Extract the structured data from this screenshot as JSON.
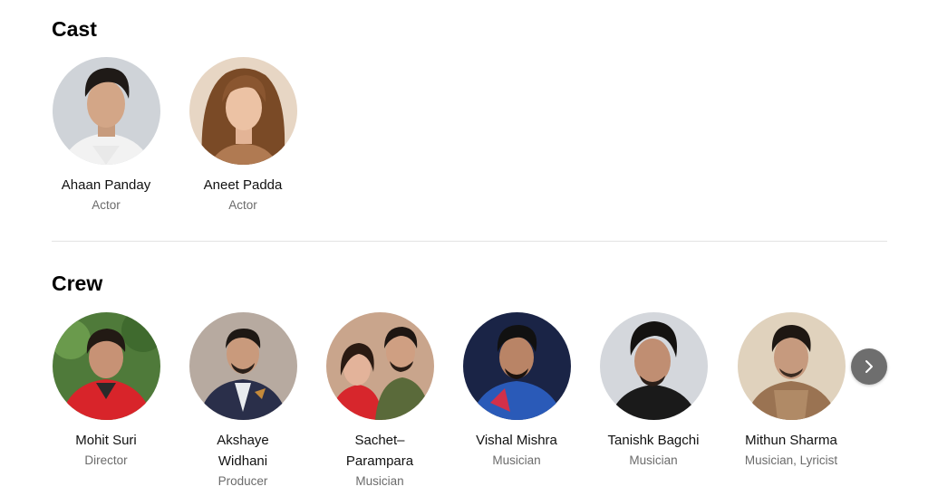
{
  "cast": {
    "title": "Cast",
    "people": [
      {
        "name": "Ahaan Panday",
        "role": "Actor"
      },
      {
        "name": "Aneet Padda",
        "role": "Actor"
      }
    ]
  },
  "crew": {
    "title": "Crew",
    "people": [
      {
        "name": "Mohit Suri",
        "role": "Director"
      },
      {
        "name": "Akshaye\nWidhani",
        "role": "Producer"
      },
      {
        "name": "Sachet–\nParampara",
        "role": "Musician"
      },
      {
        "name": "Vishal Mishra",
        "role": "Musician"
      },
      {
        "name": "Tanishk Bagchi",
        "role": "Musician"
      },
      {
        "name": "Mithun Sharma",
        "role": "Musician, Lyricist"
      }
    ],
    "next_icon": "chevron-right-icon"
  }
}
